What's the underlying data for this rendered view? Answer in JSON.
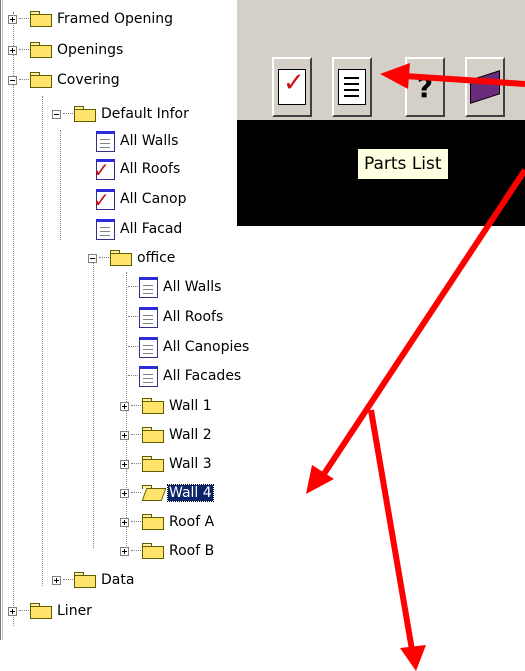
{
  "tree": {
    "items": [
      {
        "label": "Framed Opening"
      },
      {
        "label": "Openings"
      },
      {
        "label": "Covering"
      },
      {
        "label": "Default Infor"
      },
      {
        "label": "All Walls"
      },
      {
        "label": "All Roofs"
      },
      {
        "label": "All Canop"
      },
      {
        "label": "All Facad"
      },
      {
        "label": "office"
      },
      {
        "label": "All Walls"
      },
      {
        "label": "All Roofs"
      },
      {
        "label": "All Canopies"
      },
      {
        "label": "All Facades"
      },
      {
        "label": "Wall 1"
      },
      {
        "label": "Wall 2"
      },
      {
        "label": "Wall 3"
      },
      {
        "label": "Wall 4"
      },
      {
        "label": "Roof A"
      },
      {
        "label": "Roof B"
      },
      {
        "label": "Data"
      },
      {
        "label": "Liner"
      }
    ]
  },
  "toolbar": {
    "buttons": [
      {
        "icon": "checklist-icon"
      },
      {
        "icon": "parts-list-icon"
      },
      {
        "icon": "help-icon"
      },
      {
        "icon": "book-icon"
      }
    ],
    "tooltip": "Parts List"
  },
  "annotations": {
    "arrow_color": "#ff0000"
  }
}
